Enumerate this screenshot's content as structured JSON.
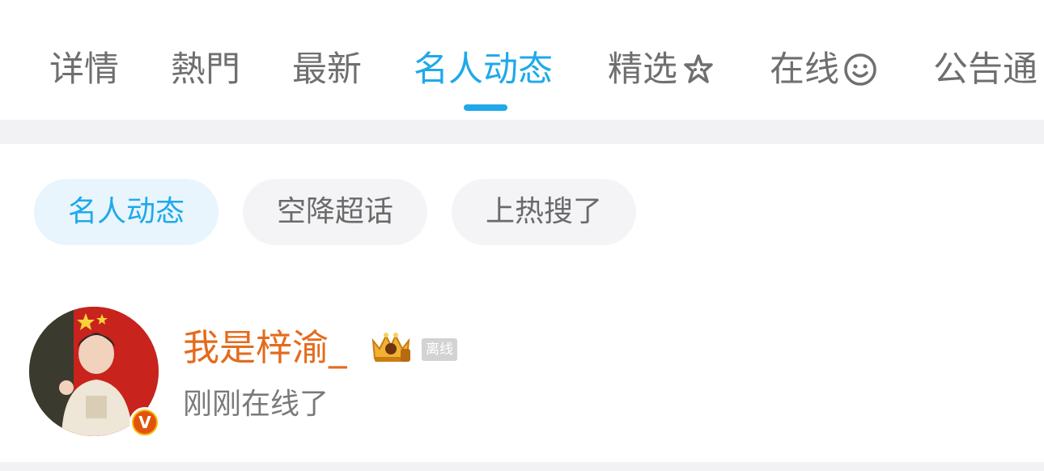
{
  "tabs": [
    {
      "label": "详情",
      "active": false
    },
    {
      "label": "熱門",
      "active": false
    },
    {
      "label": "最新",
      "active": false
    },
    {
      "label": "名人动态",
      "active": true
    },
    {
      "label": "精选",
      "active": false,
      "icon": "star-sparkle-icon"
    },
    {
      "label": "在线",
      "active": false,
      "icon": "smile-face-icon"
    },
    {
      "label": "公告通",
      "active": false
    }
  ],
  "chips": [
    {
      "label": "名人动态",
      "active": true
    },
    {
      "label": "空降超话",
      "active": false
    },
    {
      "label": "上热搜了",
      "active": false
    }
  ],
  "feed_item": {
    "username": "我是梓渝_",
    "status_tag": "离线",
    "subtext": "刚刚在线了",
    "badge_letter": "V",
    "crown_icon": "vip-crown-icon"
  },
  "colors": {
    "accent": "#1fa9ea",
    "username": "#e46b1d",
    "inactive_text": "#6f6f6f",
    "chip_bg": "#f4f4f6",
    "chip_active_bg": "#e8f5fd"
  }
}
